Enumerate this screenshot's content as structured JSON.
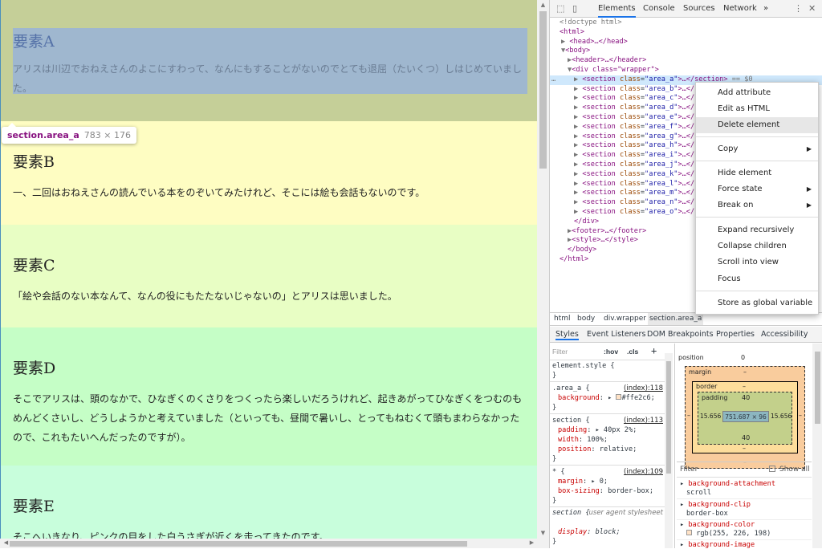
{
  "page": {
    "sections": [
      {
        "title": "要素A",
        "text": "アリスは川辺でおねえさんのよこにすわって、なんにもすることがないのでとても退屈（たいくつ）しはじめていました。"
      },
      {
        "title": "要素B",
        "text": "一、二回はおねえさんの読んでいる本をのぞいてみたけれど、そこには絵も会話もないのです。"
      },
      {
        "title": "要素C",
        "text": "「絵や会話のない本なんて、なんの役にもたたないじゃないの」とアリスは思いました。"
      },
      {
        "title": "要素D",
        "text": "そこでアリスは、頭のなかで、ひなぎくのくさりをつくったら楽しいだろうけれど、起きあがってひなぎくをつむのもめんどくさいし、どうしようかと考えていました（といっても、昼間で暑いし、とってもねむくて頭もまわらなかったので、これもたいへんだったのですが）。"
      },
      {
        "title": "要素E",
        "text": "そこへいきなり、ピンクの目をした白うさぎが近くを走ってきたのです。"
      }
    ],
    "tooltip": {
      "name": "section.area_a",
      "size": "783 × 176"
    }
  },
  "devtools": {
    "tabs": [
      "Elements",
      "Console",
      "Sources",
      "Network",
      "»"
    ],
    "active_tab": "Elements",
    "dom": {
      "doctype": "<!doctype html>",
      "html_open": "<html>",
      "head": "<head>…</head>",
      "body_open": "<body>",
      "header": "<header>…</header>",
      "wrapper_open": "<div class=\"wrapper\">",
      "sections": [
        "area_a",
        "area_b",
        "area_c",
        "area_d",
        "area_e",
        "area_f",
        "area_g",
        "area_h",
        "area_i",
        "area_j",
        "area_k",
        "area_l",
        "area_m",
        "area_n",
        "area_o"
      ],
      "selected_suffix": "== $0",
      "div_close": "</div>",
      "footer": "<footer>…</footer>",
      "style": "<style>…</style>",
      "body_close": "</body>",
      "html_close": "</html>"
    },
    "context_menu": {
      "items": [
        "Add attribute",
        "Edit as HTML",
        "Delete element",
        "Copy",
        "Hide element",
        "Force state",
        "Break on",
        "Expand recursively",
        "Collapse children",
        "Scroll into view",
        "Focus",
        "Store as global variable"
      ],
      "highlighted": "Delete element"
    },
    "breadcrumb": [
      "html",
      "body",
      "div.wrapper",
      "section.area_a"
    ],
    "subtabs": [
      "Styles",
      "Event Listeners",
      "DOM Breakpoints",
      "Properties",
      "Accessibility"
    ],
    "styles": {
      "filter_placeholder": "Filter",
      "hov": ":hov",
      "cls": ".cls",
      "plus": "+",
      "rules": [
        {
          "selector": "element.style {",
          "source": ""
        },
        {
          "selector": ".area_a {",
          "source": "(index):118",
          "props": [
            {
              "name": "background",
              "value": "#ffe2c6;"
            }
          ]
        },
        {
          "selector": "section {",
          "source": "(index):113",
          "props": [
            {
              "name": "padding",
              "value": "40px 2%;"
            },
            {
              "name": "width",
              "value": "100%;"
            },
            {
              "name": "position",
              "value": "relative;"
            }
          ]
        },
        {
          "selector": "* {",
          "source": "(index):109",
          "props": [
            {
              "name": "margin",
              "value": "0;"
            },
            {
              "name": "box-sizing",
              "value": "border-box;"
            }
          ]
        },
        {
          "selector": "section {",
          "source": "user agent stylesheet",
          "props": [
            {
              "name": "display",
              "value": "block;"
            }
          ]
        }
      ]
    },
    "boxmodel": {
      "position_label": "position",
      "position_value": "0",
      "margin_label": "margin",
      "border_label": "border",
      "padding_label": "padding",
      "padding_top": "40",
      "padding_bottom": "40",
      "padding_left": "15.656",
      "padding_right": "15.656",
      "content": "751.687 × 96",
      "dash": "–"
    },
    "computed": {
      "filter_placeholder": "Filter",
      "show_all": "Show all",
      "props": [
        {
          "name": "background-attachment",
          "value": "scroll"
        },
        {
          "name": "background-clip",
          "value": "border-box"
        },
        {
          "name": "background-color",
          "value": "rgb(255, 226, 198)"
        },
        {
          "name": "background-image",
          "value": ""
        }
      ]
    }
  }
}
